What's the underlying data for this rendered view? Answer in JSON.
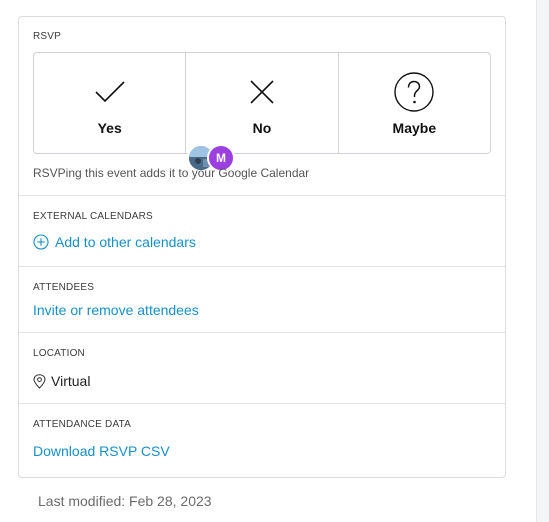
{
  "rsvp": {
    "label": "RSVP",
    "options": [
      {
        "label": "Yes",
        "icon": "check-icon"
      },
      {
        "label": "No",
        "icon": "x-icon"
      },
      {
        "label": "Maybe",
        "icon": "question-circle-icon"
      }
    ],
    "attendee_initial": "M",
    "note": "RSVPing this event adds it to your Google Calendar"
  },
  "external_calendars": {
    "label": "EXTERNAL CALENDARS",
    "link": "Add to other calendars",
    "icon": "plus-circle-icon"
  },
  "attendees": {
    "label": "ATTENDEES",
    "link": "Invite or remove attendees"
  },
  "location": {
    "label": "LOCATION",
    "value": "Virtual",
    "icon": "map-pin-icon"
  },
  "attendance_data": {
    "label": "ATTENDANCE DATA",
    "link": "Download RSVP CSV"
  },
  "footer": {
    "last_modified": "Last modified: Feb 28, 2023"
  },
  "colors": {
    "link": "#1690c9",
    "avatar": "#9b3fe0"
  }
}
